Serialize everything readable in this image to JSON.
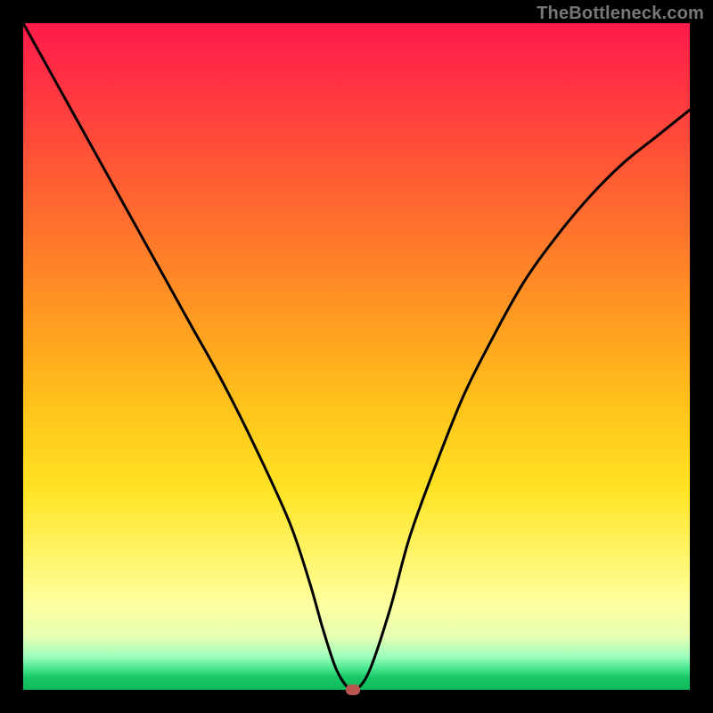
{
  "watermark": "TheBottleneck.com",
  "chart_data": {
    "type": "line",
    "title": "",
    "xlabel": "",
    "ylabel": "",
    "xlim": [
      0,
      100
    ],
    "ylim": [
      0,
      100
    ],
    "grid": false,
    "legend": false,
    "background_gradient": {
      "top": "#ff1a4b",
      "mid": "#ffe324",
      "bottom": "#0fb85c"
    },
    "series": [
      {
        "name": "bottleneck-curve",
        "color": "#000000",
        "x": [
          0,
          5,
          10,
          15,
          20,
          25,
          30,
          35,
          40,
          43,
          45,
          47,
          49,
          50,
          52,
          55,
          58,
          62,
          66,
          70,
          75,
          80,
          85,
          90,
          95,
          100
        ],
        "values": [
          100,
          91,
          82,
          73,
          64,
          55,
          46,
          36,
          25,
          16,
          9,
          3,
          0,
          0,
          3,
          12,
          23,
          34,
          44,
          52,
          61,
          68,
          74,
          79,
          83,
          87
        ]
      }
    ],
    "marker": {
      "x": 49.5,
      "y": 0,
      "color": "#b9564d",
      "shape": "rounded-rect"
    }
  }
}
